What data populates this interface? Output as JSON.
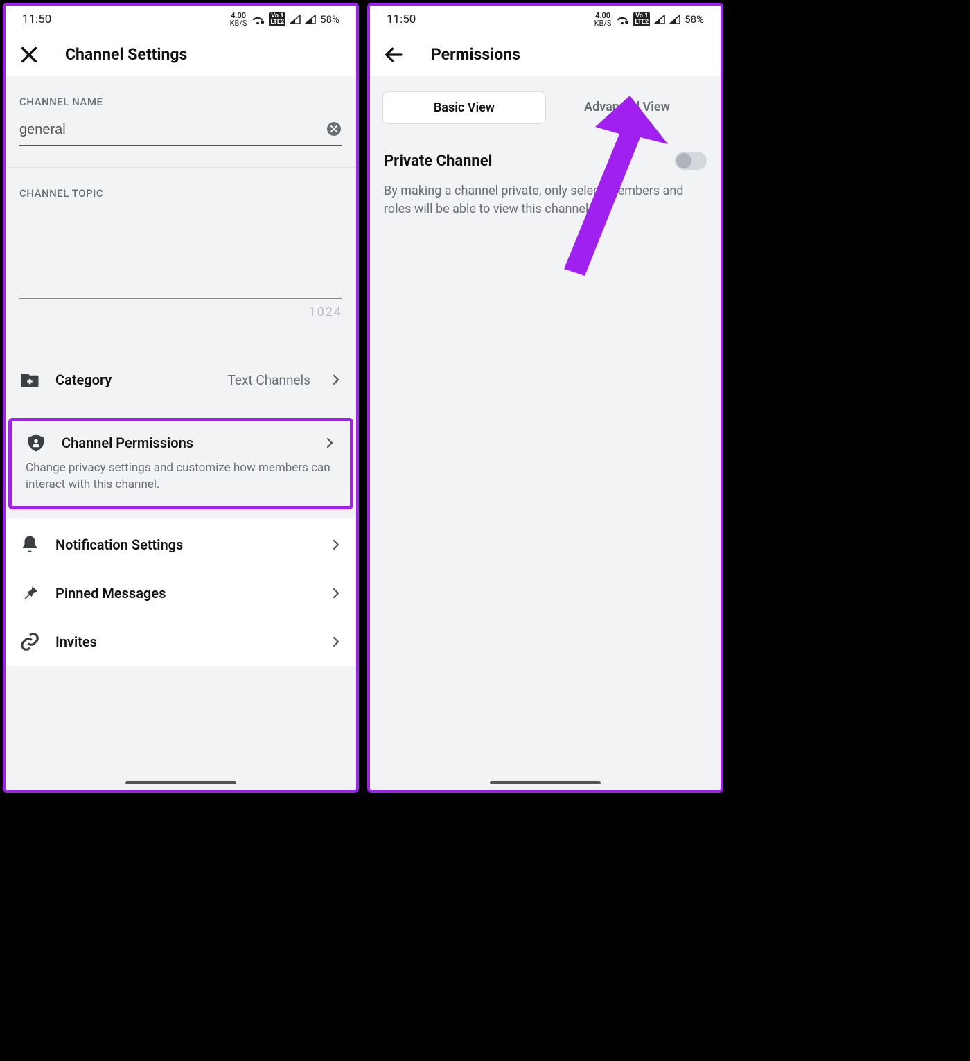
{
  "status": {
    "time": "11:50",
    "kbps_n": "4.00",
    "kbps_u": "KB/S",
    "lte1": "Vo 1",
    "lte2": "LTE2",
    "battery": "58%"
  },
  "left": {
    "header_title": "Channel Settings",
    "channel_name_label": "CHANNEL NAME",
    "channel_name_value": "general",
    "channel_topic_label": "CHANNEL TOPIC",
    "char_counter": "1024",
    "category_label": "Category",
    "category_value": "Text Channels",
    "permissions_label": "Channel Permissions",
    "permissions_desc": "Change privacy settings and customize how members can interact with this channel.",
    "notifications_label": "Notification Settings",
    "pinned_label": "Pinned Messages",
    "invites_label": "Invites"
  },
  "right": {
    "header_title": "Permissions",
    "tab_basic": "Basic View",
    "tab_advanced": "Advanced View",
    "private_title": "Private Channel",
    "private_desc": "By making a channel private, only select members and roles will be able to view this channel."
  }
}
